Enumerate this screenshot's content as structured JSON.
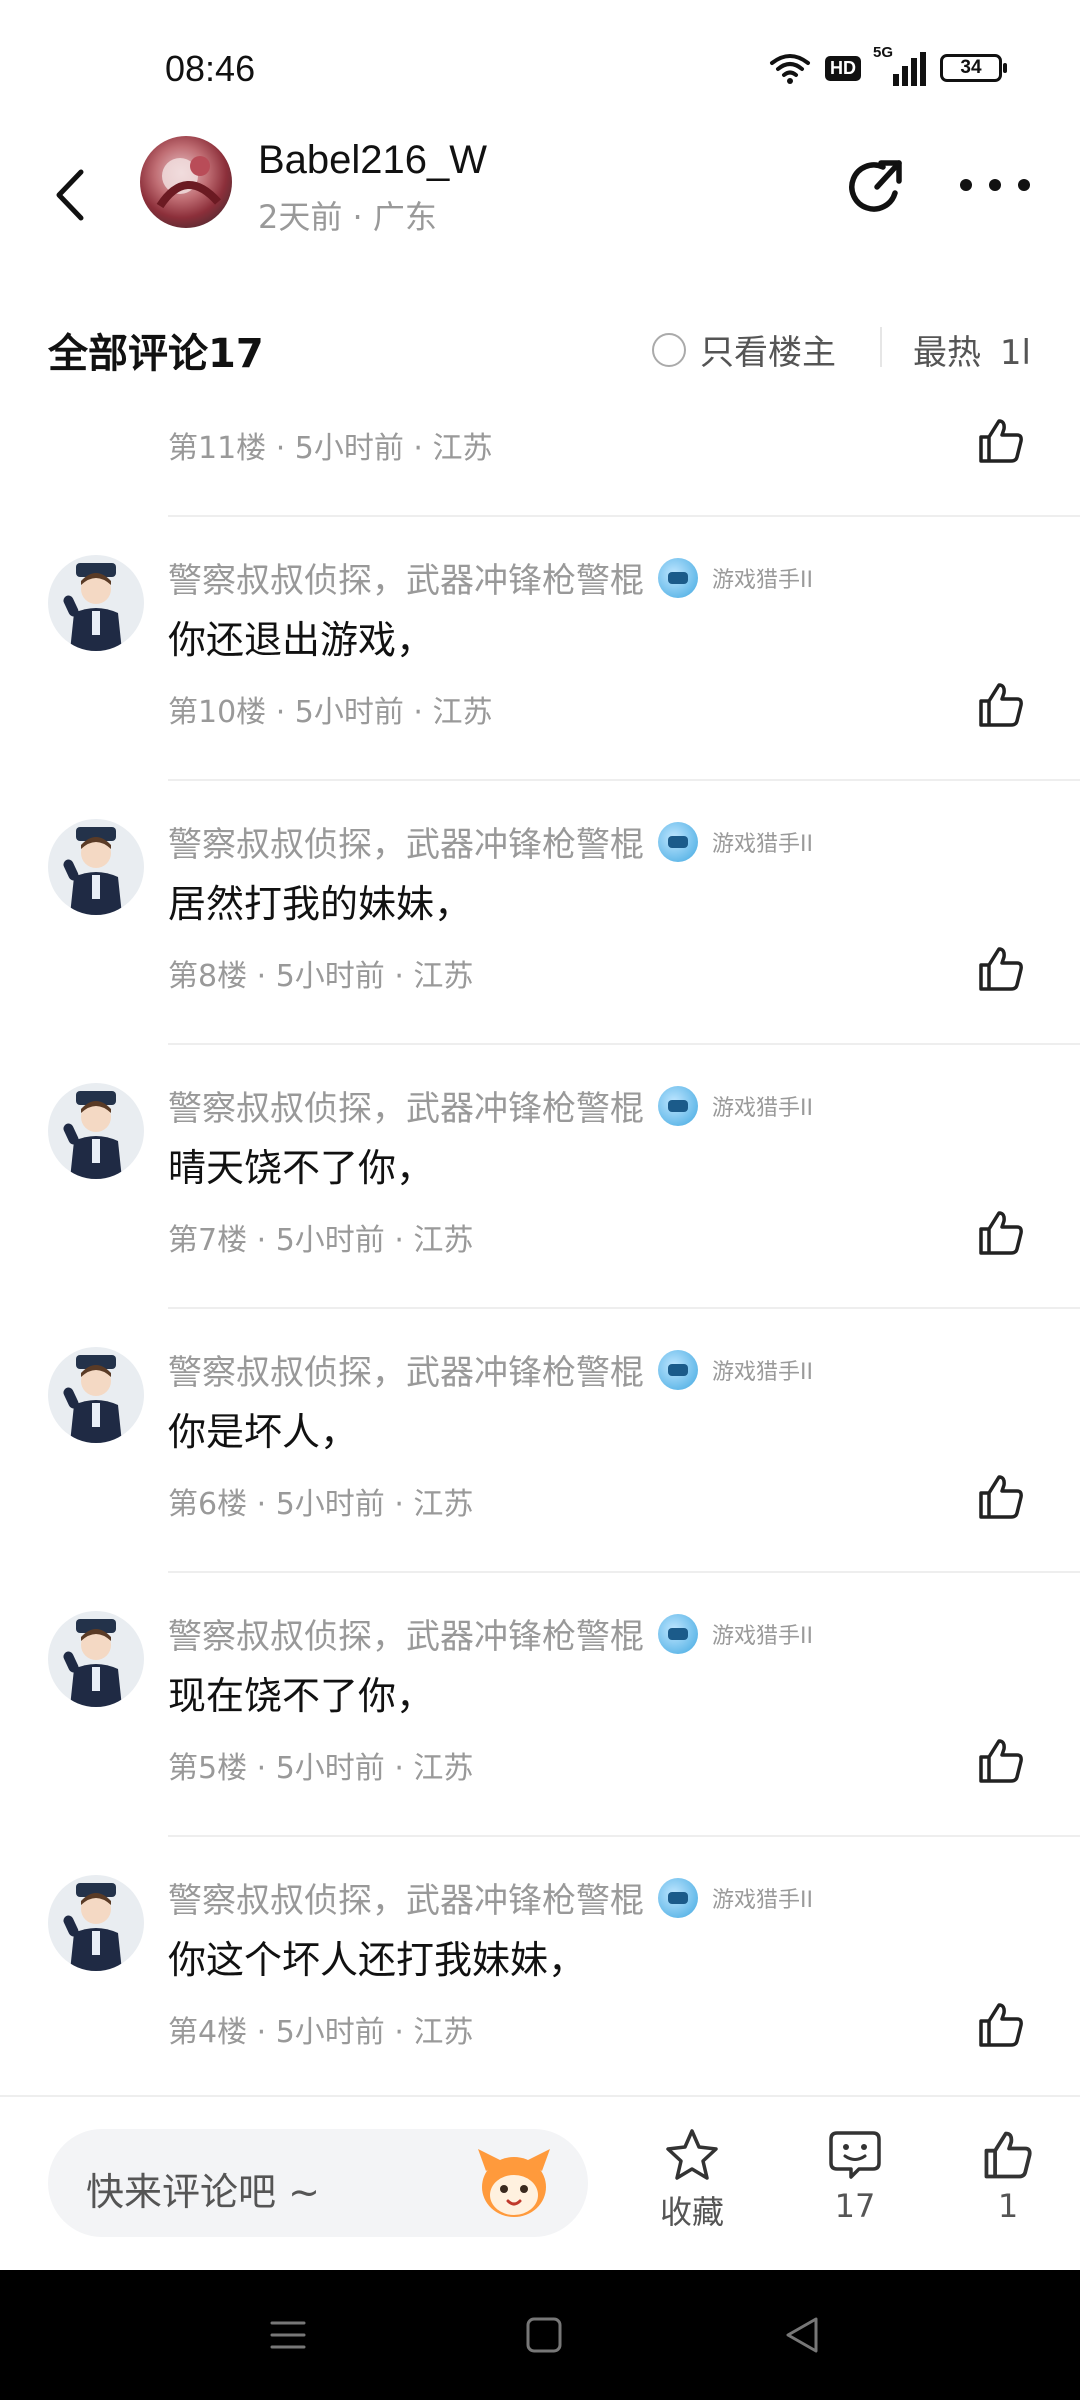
{
  "status_bar": {
    "time": "08:46",
    "network": "5G",
    "hd": "HD",
    "battery": "34"
  },
  "header": {
    "author_name": "Babel216_W",
    "author_meta": "2天前 · 广东"
  },
  "comments_header": {
    "title": "全部评论17",
    "only_op": "只看楼主",
    "sort": "最热",
    "sort_icon_text": "1l"
  },
  "comments": [
    {
      "username": "",
      "level": "",
      "text": "",
      "meta": "第11楼 · 5小时前 · 江苏",
      "partial": true
    },
    {
      "username": "警察叔叔侦探，武器冲锋枪警棍",
      "level": "游戏猎手II",
      "text": "你还退出游戏，",
      "meta": "第10楼 · 5小时前 · 江苏"
    },
    {
      "username": "警察叔叔侦探，武器冲锋枪警棍",
      "level": "游戏猎手II",
      "text": "居然打我的妹妹，",
      "meta": "第8楼 · 5小时前 · 江苏"
    },
    {
      "username": "警察叔叔侦探，武器冲锋枪警棍",
      "level": "游戏猎手II",
      "text": "晴天饶不了你，",
      "meta": "第7楼 · 5小时前 · 江苏"
    },
    {
      "username": "警察叔叔侦探，武器冲锋枪警棍",
      "level": "游戏猎手II",
      "text": "你是坏人，",
      "meta": "第6楼 · 5小时前 · 江苏"
    },
    {
      "username": "警察叔叔侦探，武器冲锋枪警棍",
      "level": "游戏猎手II",
      "text": "现在饶不了你，",
      "meta": "第5楼 · 5小时前 · 江苏"
    },
    {
      "username": "警察叔叔侦探，武器冲锋枪警棍",
      "level": "游戏猎手II",
      "text": "你这个坏人还打我妹妹，",
      "meta": "第4楼 · 5小时前 · 江苏"
    }
  ],
  "bottom_bar": {
    "input_placeholder": "快来评论吧 ~",
    "favorite_label": "收藏",
    "comment_count": "17",
    "like_count": "1"
  }
}
